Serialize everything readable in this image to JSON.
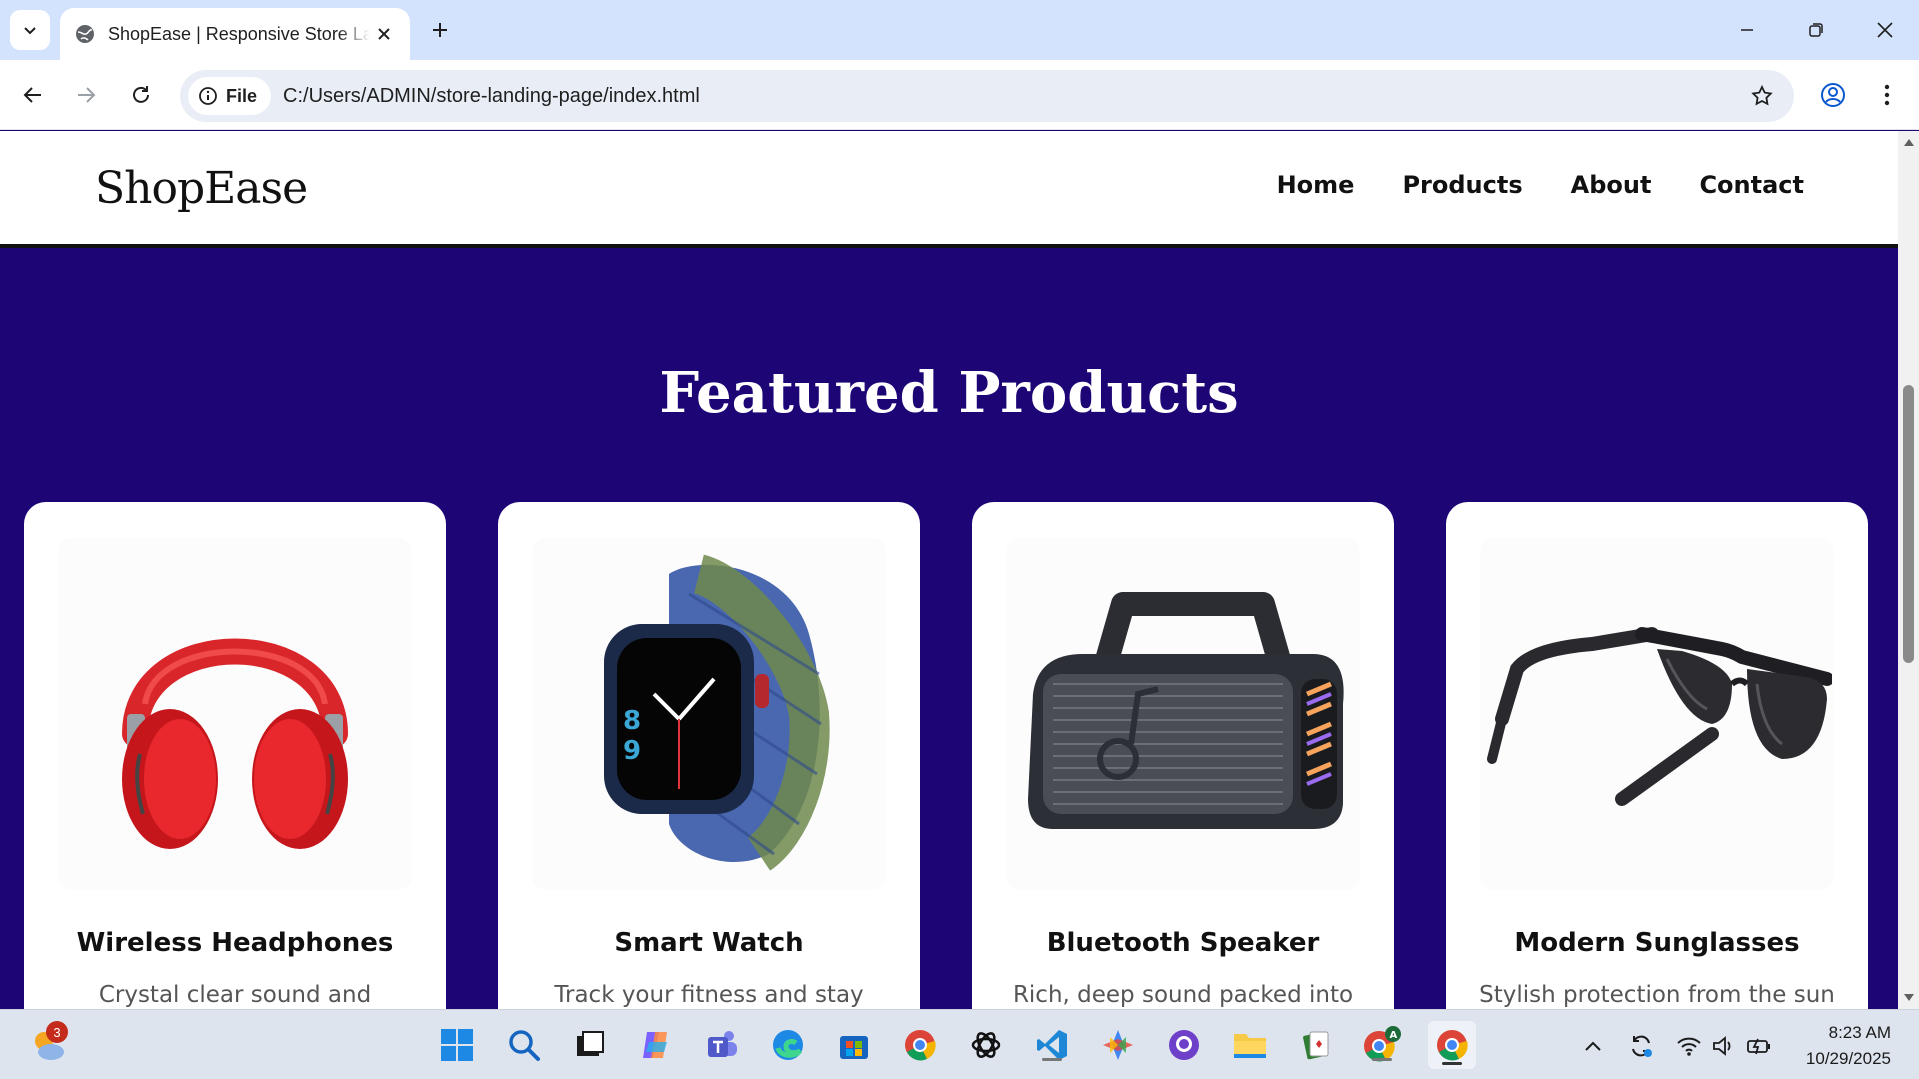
{
  "browser": {
    "tab_title": "ShopEase | Responsive Store Landing Page",
    "url_scheme_label": "File",
    "url": "C:/Users/ADMIN/store-landing-page/index.html"
  },
  "site": {
    "logo": "ShopEase",
    "nav": [
      "Home",
      "Products",
      "About",
      "Contact"
    ],
    "section_title": "Featured Products",
    "products": [
      {
        "name": "Wireless Headphones",
        "desc": "Crystal clear sound and",
        "image": "red-headphones"
      },
      {
        "name": "Smart Watch",
        "desc": "Track your fitness and stay",
        "image": "smart-watch"
      },
      {
        "name": "Bluetooth Speaker",
        "desc": "Rich, deep sound packed into",
        "image": "bluetooth-speaker"
      },
      {
        "name": "Modern Sunglasses",
        "desc": "Stylish protection from the sun",
        "image": "sunglasses"
      }
    ]
  },
  "taskbar": {
    "weather_badge": "3",
    "time": "8:23 AM",
    "date": "10/29/2025",
    "apps": [
      "weather-icon",
      "windows-start-icon",
      "search-icon",
      "task-view-icon",
      "copilot-icon",
      "teams-icon",
      "edge-icon",
      "store-icon",
      "chrome-icon",
      "chatgpt-icon",
      "vscode-icon",
      "gemini-icon",
      "github-icon",
      "file-explorer-icon",
      "solitaire-icon",
      "chrome-profile-icon",
      "chrome-active-icon"
    ]
  },
  "colors": {
    "page_background": "#1d0576",
    "tabbar": "#d3e3fd",
    "card": "#ffffff"
  }
}
